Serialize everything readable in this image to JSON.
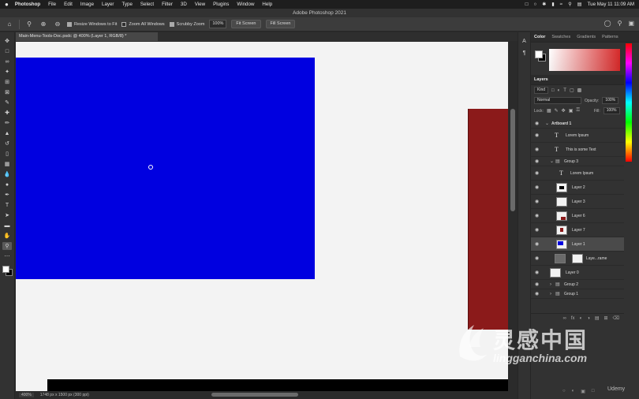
{
  "menubar": {
    "apple": "",
    "items": [
      "Photoshop",
      "File",
      "Edit",
      "Image",
      "Layer",
      "Type",
      "Select",
      "Filter",
      "3D",
      "View",
      "Plugins",
      "Window",
      "Help"
    ],
    "clock": "Tue May 11  11:09 AM"
  },
  "window": {
    "title": "Adobe Photoshop 2021"
  },
  "options": {
    "resize_windows": "Resize Windows to Fit",
    "zoom_all": "Zoom All Windows",
    "scrubby_zoom": "Scrubby Zoom",
    "zoom_value": "100%",
    "fit_screen": "Fit Screen",
    "fill_screen": "Fill Screen"
  },
  "document": {
    "tab_title": "Main-Menu-Tools-Doc.psdc @ 400% (Layer 1, RGB/8) *",
    "status_zoom": "400%",
    "status_size": "1748 px x 1500 px (300 ppi)"
  },
  "colors": {
    "blue_layer": "#0000e0",
    "red_layer": "#8b1a1a",
    "canvas_bg": "#f3f3f3"
  },
  "color_panel": {
    "tabs": [
      "Color",
      "Swatches",
      "Gradients",
      "Patterns"
    ]
  },
  "layers_panel": {
    "tab": "Layers",
    "kind": "Kind",
    "blend": "Normal",
    "opacity_label": "Opacity:",
    "opacity": "100%",
    "lock_label": "Lock:",
    "fill_label": "Fill:",
    "fill": "100%",
    "layers": [
      {
        "name": "Artboard 1",
        "type": "artboard"
      },
      {
        "name": "Lorem Ipsum",
        "type": "text"
      },
      {
        "name": "This is some Text",
        "type": "text"
      },
      {
        "name": "Group 3",
        "type": "group"
      },
      {
        "name": "Lorem Ipsum",
        "type": "text"
      },
      {
        "name": "Layer 2",
        "type": "pixel"
      },
      {
        "name": "Layer 3",
        "type": "pixel"
      },
      {
        "name": "Layer 6",
        "type": "pixel"
      },
      {
        "name": "Layer 7",
        "type": "pixel"
      },
      {
        "name": "Layer 1",
        "type": "pixel"
      },
      {
        "name": "Laye...rame",
        "type": "frame"
      },
      {
        "name": "Layer 0",
        "type": "pixel"
      },
      {
        "name": "Group 2",
        "type": "group"
      },
      {
        "name": "Group 1",
        "type": "group"
      }
    ]
  },
  "watermark": {
    "cn": "灵感中国",
    "en": "lingganchina.com",
    "udemy": "Udemy"
  }
}
